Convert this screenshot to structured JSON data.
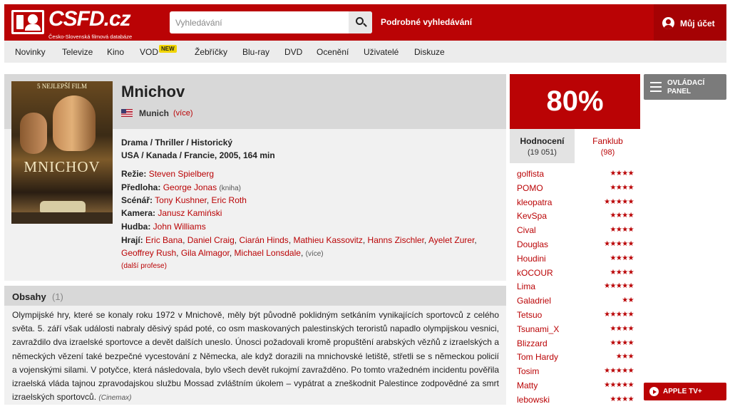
{
  "header": {
    "logo_text": "CSFD.cz",
    "logo_sub": "Česko-Slovenská filmová databáze",
    "search_placeholder": "Vyhledávání",
    "advanced_search": "Podrobné vyhledávání",
    "account": "Můj účet"
  },
  "nav": {
    "items": [
      "Novinky",
      "Televize",
      "Kino",
      "VOD",
      "Žebříčky",
      "Blu-ray",
      "DVD",
      "Ocenění",
      "Uživatelé",
      "Diskuze"
    ],
    "vod_badge": "NEW"
  },
  "movie": {
    "title": "Mnichov",
    "original_name": "Munich",
    "original_more": "(více)",
    "genres": "Drama / Thriller / Historický",
    "origin": "USA / Kanada / Francie, 2005, 164 min",
    "poster": {
      "tagline": "5 NEJLEPŠÍ FILM",
      "title": "MNICHOV"
    },
    "crew": {
      "director_label": "Režie:",
      "director": "Steven Spielberg",
      "source_label": "Předloha:",
      "source": "George Jonas",
      "source_note": "(kniha)",
      "writers_label": "Scénář:",
      "writers": [
        "Tony Kushner",
        "Eric Roth"
      ],
      "camera_label": "Kamera:",
      "camera": "Janusz Kamiński",
      "music_label": "Hudba:",
      "music": "John Williams",
      "cast_label": "Hrají:",
      "cast": [
        "Eric Bana",
        "Daniel Craig",
        "Ciarán Hinds",
        "Mathieu Kassovitz",
        "Hanns Zischler",
        "Ayelet Zurer",
        "Geoffrey Rush",
        "Gila Almagor",
        "Michael Lonsdale"
      ],
      "cast_more": "(více)",
      "other": "(další profese)"
    }
  },
  "plot": {
    "title": "Obsahy",
    "count": "(1)",
    "text": "Olympijské hry, které se konaly roku 1972 v Mnichově, měly být původně poklidným setkáním vynikajících sportovců z celého světa. 5. září však události nabraly děsivý spád poté, co osm maskovaných palestinských teroristů napadlo olympijskou vesnici, zavraždilo dva izraelské sportovce a devět dalších uneslo. Únosci požadovali kromě propuštění arabských vězňů z izraelských a německých vězení také bezpečné vycestování z Německa, ale když dorazili na mnichovské letiště, střetli se s německou policií a vojenskými silami. V potyčce, která následovala, bylo všech devět rukojmí zavražděno. Po tomto vražedném incidentu pověřila izraelská vláda tajnou zpravodajskou službu Mossad zvláštním úkolem – vypátrat a zneškodnit Palestince zodpovědné za smrt izraelských sportovců.",
    "source": "(Cinemax)"
  },
  "rating": {
    "score": "80%",
    "tab_ratings": "Hodnocení",
    "tab_ratings_count": "(19 051)",
    "tab_fanclub": "Fanklub",
    "tab_fanclub_count": "(98)",
    "users": [
      {
        "name": "golfista",
        "stars": "★★★★"
      },
      {
        "name": "POMO",
        "stars": "★★★★"
      },
      {
        "name": "kleopatra",
        "stars": "★★★★★"
      },
      {
        "name": "KevSpa",
        "stars": "★★★★"
      },
      {
        "name": "Cival",
        "stars": "★★★★"
      },
      {
        "name": "Douglas",
        "stars": "★★★★★"
      },
      {
        "name": "Houdini",
        "stars": "★★★★"
      },
      {
        "name": "kOCOUR",
        "stars": "★★★★"
      },
      {
        "name": "Lima",
        "stars": "★★★★★"
      },
      {
        "name": "Galadriel",
        "stars": "★★"
      },
      {
        "name": "Tetsuo",
        "stars": "★★★★★"
      },
      {
        "name": "Tsunami_X",
        "stars": "★★★★"
      },
      {
        "name": "Blizzard",
        "stars": "★★★★"
      },
      {
        "name": "Tom Hardy",
        "stars": "★★★"
      },
      {
        "name": "Tosim",
        "stars": "★★★★★"
      },
      {
        "name": "Matty",
        "stars": "★★★★★"
      },
      {
        "name": "lebowski",
        "stars": "★★★★"
      }
    ]
  },
  "side": {
    "control_panel": "OVLÁDACÍ PANEL",
    "appletv": "APPLE TV+"
  },
  "colors": {
    "brand": "#ba0305",
    "nav_bg": "#ececec",
    "panel_bg": "#f1f1f1"
  },
  "icons": [
    "search-icon",
    "user-icon",
    "us-flag-icon",
    "menu-icon",
    "play-icon",
    "star-icon"
  ]
}
